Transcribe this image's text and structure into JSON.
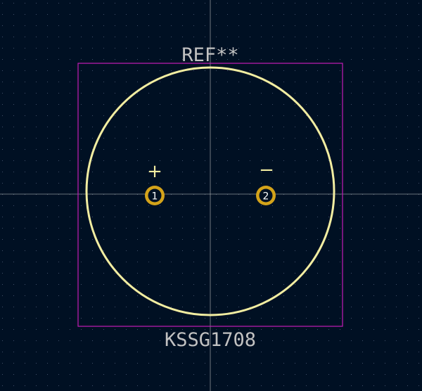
{
  "footprint": {
    "reference": "REF**",
    "value": "KSSG1708",
    "polarity": {
      "positive": "+",
      "negative": "−"
    },
    "pads": [
      {
        "number": "1"
      },
      {
        "number": "2"
      }
    ]
  },
  "colors": {
    "background": "#001023",
    "grid_dot": "#40506a",
    "crosshair": "#c8c8c8",
    "courtyard": "#c41db8",
    "silkscreen_outline": "#f2eda1",
    "fab_text": "#c2c2c2",
    "pad_ring": "#d4a31a",
    "pad_hole": "#001023",
    "polarity_mark": "#f2eda1"
  }
}
